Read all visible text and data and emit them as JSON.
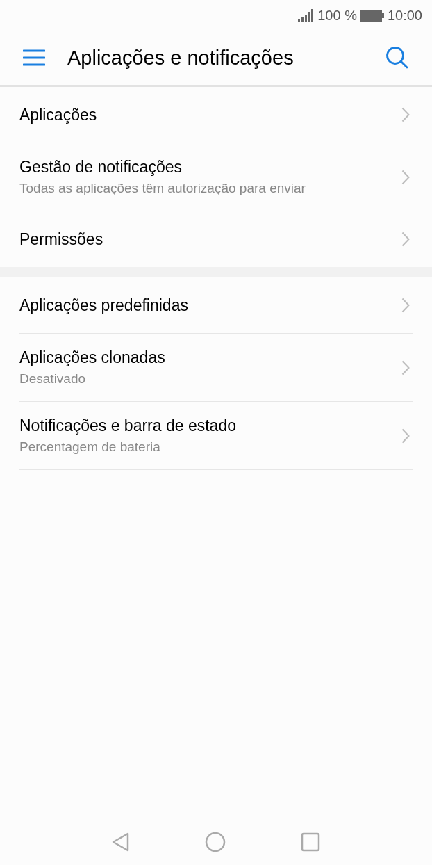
{
  "status_bar": {
    "battery": "100 %",
    "time": "10:00"
  },
  "app_bar": {
    "title": "Aplicações e notificações"
  },
  "sections": [
    {
      "items": [
        {
          "title": "Aplicações"
        },
        {
          "title": "Gestão de notificações",
          "subtitle": "Todas as aplicações têm autorização para enviar"
        },
        {
          "title": "Permissões"
        }
      ]
    },
    {
      "items": [
        {
          "title": "Aplicações predefinidas"
        },
        {
          "title": "Aplicações clonadas",
          "subtitle": "Desativado"
        },
        {
          "title": "Notificações e barra de estado",
          "subtitle": "Percentagem de bateria"
        }
      ]
    }
  ]
}
